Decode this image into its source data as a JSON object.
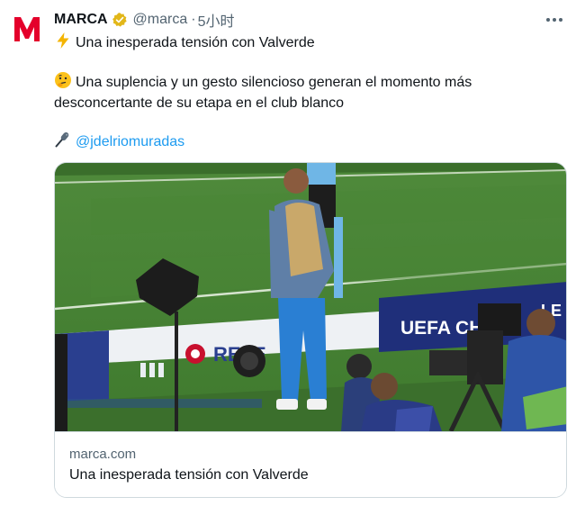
{
  "tweet": {
    "author_name": "MARCA",
    "handle": "@marca",
    "separator": "·",
    "time": "5小时",
    "line1": "Una inesperada tensión con Valverde",
    "line2a": "Una suplencia y un gesto silencioso generan el momento más",
    "line2b": "desconcertante de su etapa en el club blanco",
    "mention": "@jdelriomuradas"
  },
  "card": {
    "domain": "marca.com",
    "title": "Una inesperada tensión con Valverde",
    "image": {
      "ad_board_text": "UEFA CH",
      "ad_board_suffix": "LE",
      "ad_board_text2": "REFE"
    }
  },
  "icons": {
    "avatar": "marca-logo-icon",
    "verified": "verified-badge-icon",
    "line1": "lightning-icon",
    "line2": "thinking-face-icon",
    "line3": "microphone-icon",
    "more": "more-dots-icon"
  },
  "colors": {
    "link": "#1d9bf0",
    "secondary_text": "#536471",
    "brand_red": "#e4002b",
    "verified_gold": "#e2b719"
  }
}
